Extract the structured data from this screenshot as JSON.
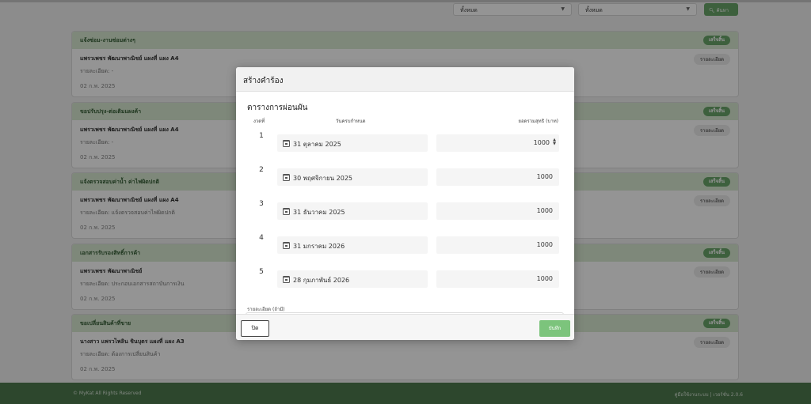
{
  "filters": {
    "select1": "ทั้งหมด",
    "select2": "ทั้งหมด",
    "search_label": "ค้นหา"
  },
  "cards": [
    {
      "category": "แจ้งซ่อม-งานซ่อมต่างๆ",
      "status": "เสร็จสิ้น",
      "title": "แพรวเพชร พัฒนาพาณิชย์ แผงที่ แผง A4",
      "detail": "รายละเอียด: -",
      "date": "02 ก.พ. 2025",
      "detail_button": "รายละเอียด"
    },
    {
      "category": "ขอปรับปรุง-ต่อเติมแผงค้า",
      "status": "เสร็จสิ้น",
      "title": "แพรวเพชร พัฒนาพาณิชย์ แผงที่ แผง A4",
      "detail": "รายละเอียด: -",
      "date": "02 ก.พ. 2025",
      "detail_button": "รายละเอียด"
    },
    {
      "category": "แจ้งตรวจสอบค่าน้ำ ค่าไฟผิดปกติ",
      "status": "เสร็จสิ้น",
      "title": "แพรวเพชร พัฒนาพาณิชย์ แผงที่ แผง A4",
      "detail": "รายละเอียด: แจ้งตรวจสอบค่าไฟผิดปกติ",
      "date": "02 ก.พ. 2025",
      "detail_button": "รายละเอียด"
    },
    {
      "category": "เอกสารรับรองสิทธิ์การค้า",
      "status": "เสร็จสิ้น",
      "title": "แพรวเพชร พัฒนาพาณิชย์",
      "detail": "รายละเอียด: ประกอบเอกสารสถาบันการเงิน",
      "date": "02 ก.พ. 2025",
      "detail_button": "รายละเอียด"
    },
    {
      "category": "ขอเปลี่ยนสินค้าที่ขาย",
      "status": "เสร็จสิ้น",
      "title": "นางสาว แพรวไพลิน ชินบุตร แผงที่ แผง A3",
      "detail": "รายละเอียด: ต้องการเปลี่ยนสินค้า",
      "date": "02 ก.พ. 2025",
      "detail_button": "รายละเอียด"
    }
  ],
  "modal": {
    "title": "สร้างคำร้อง",
    "section_title": "ตารางการผ่อนผัน",
    "columns": {
      "installment": "งวดที่",
      "due_date": "วันครบกำหนด",
      "amount": "ยอดรวมสุทธิ (บาท)"
    },
    "rows": [
      {
        "num": "1",
        "date": "31 ตุลาคม 2025",
        "amount": "1000"
      },
      {
        "num": "2",
        "date": "30 พฤศจิกายน 2025",
        "amount": "1000"
      },
      {
        "num": "3",
        "date": "31 ธันวาคม 2025",
        "amount": "1000"
      },
      {
        "num": "4",
        "date": "31 มกราคม 2026",
        "amount": "1000"
      },
      {
        "num": "5",
        "date": "28 กุมภาพันธ์ 2026",
        "amount": "1000"
      }
    ],
    "note_label": "รายละเอียด (ถ้ามี)",
    "close_label": "ปิด",
    "save_label": "บันทึก"
  },
  "footer": {
    "copyright": "© MyKat All Rights Reserved",
    "version": "คู่มือใช้งานระบบ | เวอร์ชั่น 2.0.6"
  },
  "colors": {
    "accent": "#6aa56a",
    "card_header": "#d9ead3",
    "footer": "#4e7a4e"
  }
}
